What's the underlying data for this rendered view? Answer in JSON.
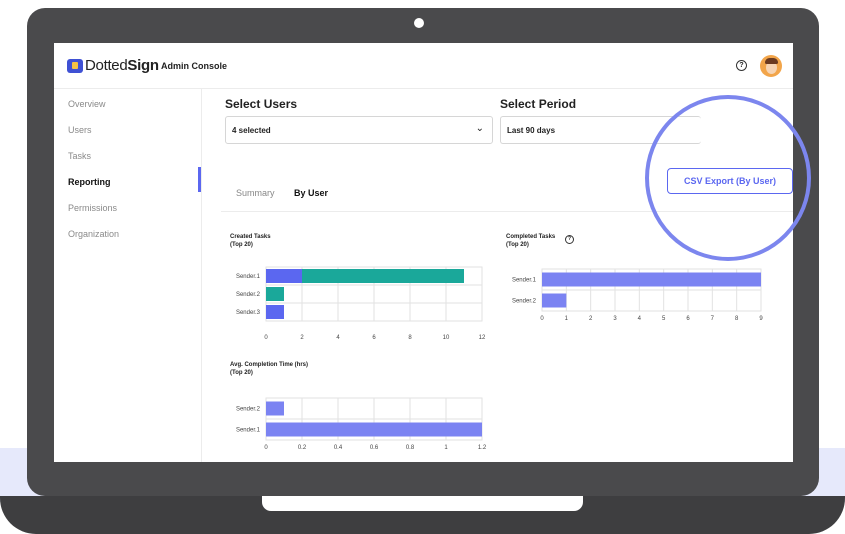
{
  "header": {
    "logo_text_light": "Dotted",
    "logo_text_bold": "Sign",
    "console_title": "Admin Console",
    "help_icon": "?"
  },
  "sidebar": {
    "items": [
      {
        "label": "Overview",
        "active": false
      },
      {
        "label": "Users",
        "active": false
      },
      {
        "label": "Tasks",
        "active": false
      },
      {
        "label": "Reporting",
        "active": true
      },
      {
        "label": "Permissions",
        "active": false
      },
      {
        "label": "Organization",
        "active": false
      }
    ]
  },
  "filters": {
    "users_label": "Select Users",
    "users_value": "4 selected",
    "period_label": "Select Period",
    "period_value": "Last 90 days"
  },
  "tabs": [
    {
      "label": "Summary",
      "active": false
    },
    {
      "label": "By User",
      "active": true
    }
  ],
  "export_button": "CSV Export (By User)",
  "colors": {
    "accent": "#5b67f0",
    "bar_primary": "#7b83f2",
    "bar_secondary": "#1aa89a",
    "ring": "#7c86ee"
  },
  "chart_data": [
    {
      "type": "bar",
      "orientation": "horizontal",
      "stacked": true,
      "title_line1": "Created Tasks",
      "title_line2": "(Top 20)",
      "categories": [
        "Sender.1",
        "Sender.2",
        "Sender.3"
      ],
      "series": [
        {
          "color": "#5b67f0",
          "values": [
            2,
            0,
            1
          ]
        },
        {
          "color": "#1aa89a",
          "values": [
            9,
            1,
            0
          ]
        }
      ],
      "xlim": [
        0,
        12
      ],
      "ticks": [
        "0",
        "2",
        "4",
        "6",
        "8",
        "10",
        "12"
      ],
      "tick_values": [
        0,
        2,
        4,
        6,
        8,
        10,
        12
      ],
      "grid": true
    },
    {
      "type": "bar",
      "orientation": "horizontal",
      "title_line1": "Completed Tasks",
      "title_line2": "(Top 20)",
      "help_icon": "?",
      "categories": [
        "Sender.1",
        "Sender.2"
      ],
      "series": [
        {
          "color": "#7b83f2",
          "values": [
            9,
            1
          ]
        }
      ],
      "xlim": [
        0,
        9
      ],
      "ticks": [
        "0",
        "1",
        "2",
        "3",
        "4",
        "5",
        "6",
        "7",
        "8",
        "9"
      ],
      "tick_values": [
        0,
        1,
        2,
        3,
        4,
        5,
        6,
        7,
        8,
        9
      ],
      "grid": true
    },
    {
      "type": "bar",
      "orientation": "horizontal",
      "title_line1": "Avg. Completion Time (hrs)",
      "title_line2": "(Top 20)",
      "categories": [
        "Sender.2",
        "Sender.1"
      ],
      "series": [
        {
          "color": "#7b83f2",
          "values": [
            0.1,
            1.2
          ]
        }
      ],
      "xlim": [
        0,
        1.2
      ],
      "ticks": [
        "0",
        "0.2",
        "0.4",
        "0.6",
        "0.8",
        "1",
        "1.2"
      ],
      "tick_values": [
        0,
        0.2,
        0.4,
        0.6,
        0.8,
        1,
        1.2
      ],
      "grid": true
    }
  ]
}
